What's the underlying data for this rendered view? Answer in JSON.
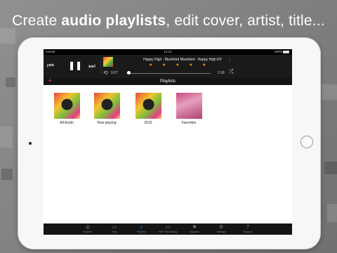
{
  "headline": {
    "prefix": "Create ",
    "bold": "audio playlists",
    "suffix": ", edit cover, artist, title..."
  },
  "status_bar": {
    "carrier": "Carrier",
    "time": "12:12",
    "battery": "100%"
  },
  "player": {
    "track_info": "Happy High - Blackbird Blackbird - Happy High EP",
    "rating": "★ ★ ★ ★ ★",
    "elapsed": "0:07",
    "remaining": "2:36",
    "progress": 0.03
  },
  "playlists_header": {
    "title": "Playlists",
    "add_symbol": "+"
  },
  "playlists": [
    {
      "name": "All Audio",
      "cover": "album"
    },
    {
      "name": "Now playing",
      "cover": "album"
    },
    {
      "name": "2015",
      "cover": "album"
    },
    {
      "name": "Favorites",
      "cover": "fav"
    }
  ],
  "tabs": [
    {
      "label": "Explorer",
      "icon": "globe-icon",
      "active": false
    },
    {
      "label": "Files",
      "icon": "folder-icon",
      "active": false
    },
    {
      "label": "Playlists",
      "icon": "music-note-icon",
      "active": true
    },
    {
      "label": "WiFi File Sharing",
      "icon": "monitor-icon",
      "active": false
    },
    {
      "label": "Dropbox",
      "icon": "dropbox-icon",
      "active": false
    },
    {
      "label": "Settings",
      "icon": "gear-icon",
      "active": false
    },
    {
      "label": "Support",
      "icon": "question-icon",
      "active": false
    }
  ],
  "colors": {
    "accent": "#3a86e0",
    "add_button": "#e03030",
    "stars": "#f39c12"
  }
}
